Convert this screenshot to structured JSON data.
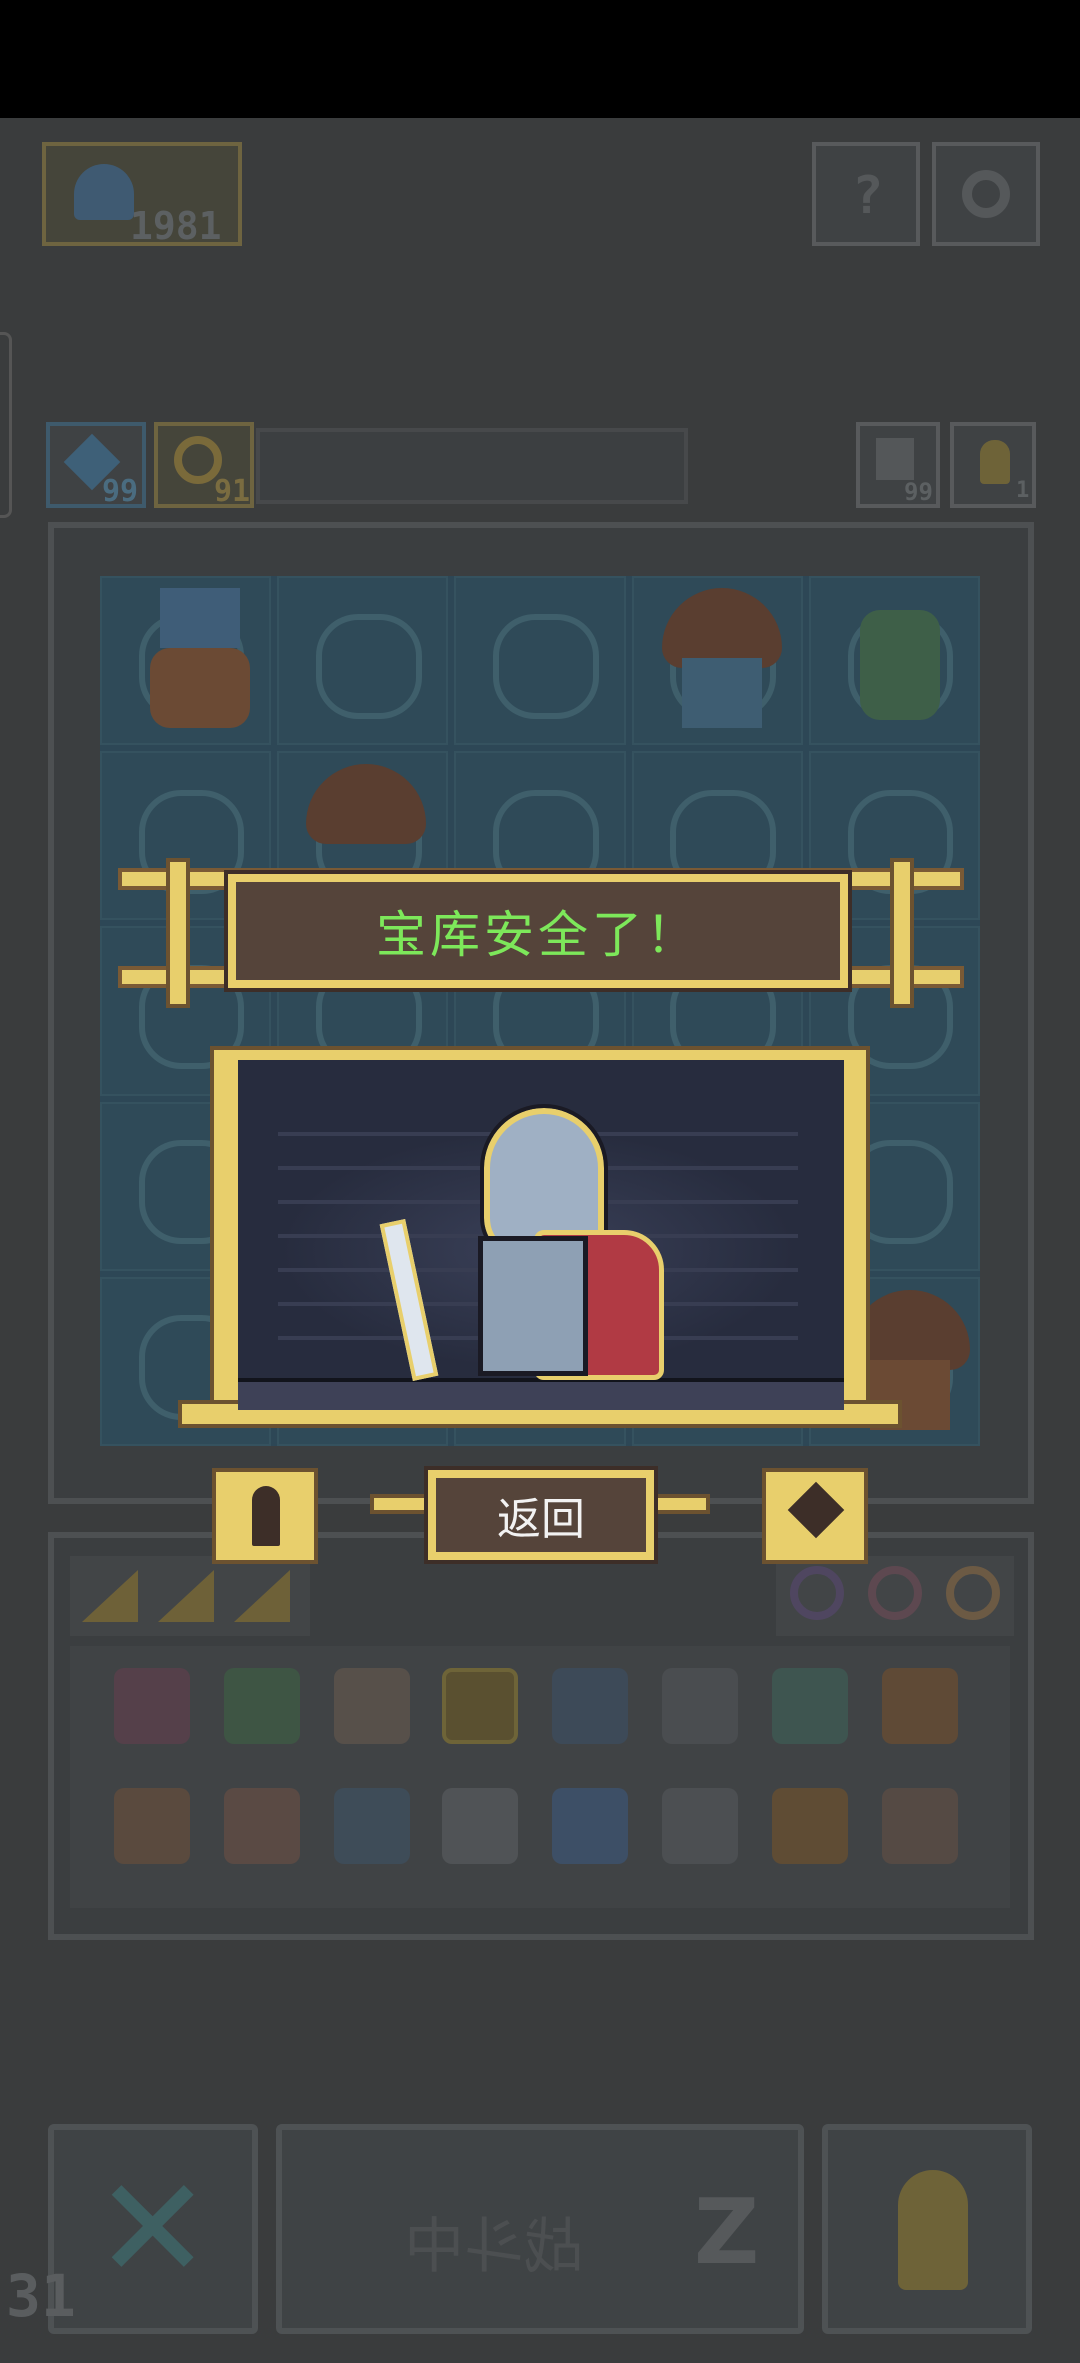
{
  "status_bar": {},
  "top": {
    "trophy_count": "1981"
  },
  "resources": {
    "blue_count": "99",
    "gold_count": "91",
    "house_count": "99",
    "pawn_count": "1"
  },
  "dialog": {
    "title": "宝库安全了！",
    "back_label": "返回"
  },
  "bottom_bar": {
    "battle_label": "战斗中",
    "corner_number": "31"
  },
  "colors": {
    "title_green": "#7de85a",
    "frame_gold": "#e8cf6c",
    "plate_brown": "#55443a"
  }
}
